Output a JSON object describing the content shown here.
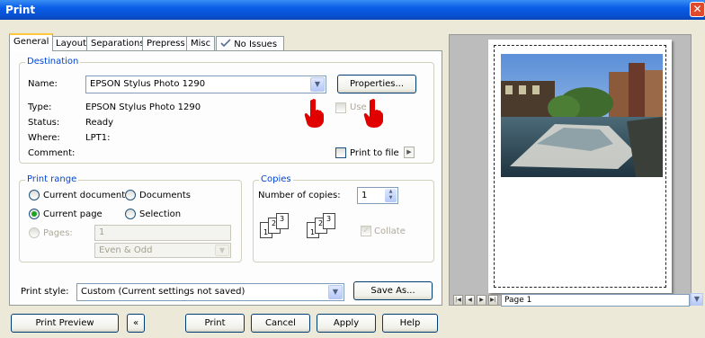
{
  "window": {
    "title": "Print",
    "close_glyph": "✕"
  },
  "tabs": [
    {
      "label": "General"
    },
    {
      "label": "Layout"
    },
    {
      "label": "Separations"
    },
    {
      "label": "Prepress"
    },
    {
      "label": "Misc"
    },
    {
      "label": "No Issues"
    }
  ],
  "destination": {
    "legend": "Destination",
    "name_label": "Name:",
    "name_value": "EPSON Stylus Photo 1290",
    "properties_button": "Properties...",
    "type_label": "Type:",
    "type_value": "EPSON Stylus Photo 1290",
    "status_label": "Status:",
    "status_value": "Ready",
    "where_label": "Where:",
    "where_value": "LPT1:",
    "comment_label": "Comment:",
    "use_label": "Use",
    "print_to_file_label": "Print to file"
  },
  "print_range": {
    "legend": "Print range",
    "current_document": "Current document",
    "documents": "Documents",
    "current_page": "Current page",
    "selection": "Selection",
    "pages_label": "Pages:",
    "pages_value": "1",
    "even_odd": "Even & Odd"
  },
  "copies": {
    "legend": "Copies",
    "number_label": "Number of copies:",
    "number_value": "1",
    "collate_label": "Collate",
    "collate_icon_left": [
      "1",
      "2",
      "3"
    ],
    "collate_icon_right": [
      "1",
      "2",
      "3"
    ]
  },
  "print_style": {
    "label": "Print style:",
    "value": "Custom (Current settings not saved)",
    "save_as": "Save As..."
  },
  "preview": {
    "page_label": "Page 1"
  },
  "buttons": {
    "print_preview": "Print Preview",
    "collapse_glyph": "«",
    "print": "Print",
    "cancel": "Cancel",
    "apply": "Apply",
    "help": "Help"
  },
  "colors": {
    "titlebar": "#0a5ce6",
    "legend": "#0046d5",
    "active_tab_accent": "#ffc83c",
    "pointer_hand": "#e00000"
  }
}
